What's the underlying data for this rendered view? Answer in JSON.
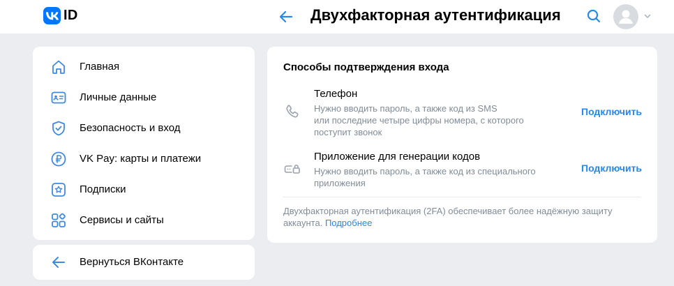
{
  "header": {
    "logo_text": "ID",
    "title": "Двухфакторная аутентификация"
  },
  "sidebar": {
    "items": [
      {
        "label": "Главная",
        "icon": "home-icon"
      },
      {
        "label": "Личные данные",
        "icon": "id-card-icon"
      },
      {
        "label": "Безопасность и вход",
        "icon": "shield-icon"
      },
      {
        "label": "VK Pay: карты и платежи",
        "icon": "ruble-icon"
      },
      {
        "label": "Подписки",
        "icon": "star-icon"
      },
      {
        "label": "Сервисы и сайты",
        "icon": "services-grid-icon"
      }
    ],
    "back_label": "Вернуться ВКонтакте"
  },
  "content": {
    "section_title": "Способы подтверждения входа",
    "methods": [
      {
        "title": "Телефон",
        "desc_lines": [
          "Нужно вводить пароль, а также код из SMS",
          "или последние четыре цифры номера, с которого",
          "поступит звонок"
        ],
        "action": "Подключить",
        "icon": "phone-icon"
      },
      {
        "title": "Приложение для генерации кодов",
        "desc_lines": [
          "Нужно вводить пароль, а также код из специального",
          "приложения"
        ],
        "action": "Подключить",
        "icon": "password-lock-icon"
      }
    ],
    "footnote_line1": "Двухфакторная аутентификация (2FA) обеспечивает более надёжную защиту",
    "footnote_line2": "аккаунта.",
    "footnote_link": "Подробнее"
  },
  "colors": {
    "accent": "#2688eb",
    "icon_blue": "#3f8ae0",
    "secondary_text": "#818c99",
    "background": "#ebedf0",
    "brand": "#0077ff"
  }
}
